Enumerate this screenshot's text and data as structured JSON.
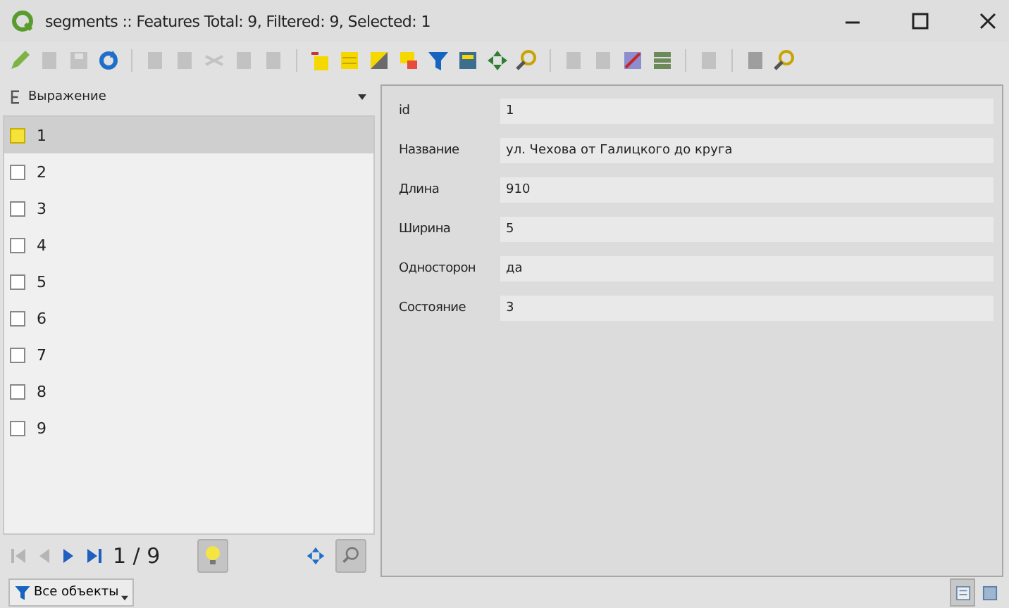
{
  "window": {
    "title": "segments :: Features Total: 9, Filtered: 9, Selected: 1"
  },
  "toolbar": [
    [
      {
        "kind": "pencil",
        "disabled": false
      },
      {
        "kind": "doc",
        "disabled": true
      },
      {
        "kind": "save",
        "disabled": true
      },
      {
        "kind": "refresh",
        "disabled": false
      }
    ],
    [
      {
        "kind": "doc",
        "disabled": true
      },
      {
        "kind": "doc",
        "disabled": true
      },
      {
        "kind": "scissors",
        "disabled": true
      },
      {
        "kind": "doc",
        "disabled": true
      },
      {
        "kind": "doc",
        "disabled": true
      }
    ],
    [
      {
        "kind": "select-expr",
        "disabled": false
      },
      {
        "kind": "select-all",
        "disabled": false
      },
      {
        "kind": "invert",
        "disabled": false
      },
      {
        "kind": "deselect",
        "disabled": false
      },
      {
        "kind": "filter",
        "disabled": false
      },
      {
        "kind": "move-top",
        "disabled": false
      },
      {
        "kind": "pan",
        "disabled": false
      },
      {
        "kind": "zoom",
        "disabled": false
      }
    ],
    [
      {
        "kind": "doc",
        "disabled": true
      },
      {
        "kind": "doc",
        "disabled": true
      },
      {
        "kind": "delete-field",
        "disabled": false
      },
      {
        "kind": "calc-field",
        "disabled": false
      }
    ],
    [
      {
        "kind": "doc",
        "disabled": true
      }
    ],
    [
      {
        "kind": "doc",
        "disabled": false
      },
      {
        "kind": "zoom",
        "disabled": false
      }
    ]
  ],
  "list_header": {
    "label": "Выражение"
  },
  "rows": [
    {
      "label": "1",
      "selected": true
    },
    {
      "label": "2",
      "selected": false
    },
    {
      "label": "3",
      "selected": false
    },
    {
      "label": "4",
      "selected": false
    },
    {
      "label": "5",
      "selected": false
    },
    {
      "label": "6",
      "selected": false
    },
    {
      "label": "7",
      "selected": false
    },
    {
      "label": "8",
      "selected": false
    },
    {
      "label": "9",
      "selected": false
    }
  ],
  "navigation": {
    "counter": "1 / 9",
    "buttons": [
      {
        "kind": "first",
        "disabled": true
      },
      {
        "kind": "prev",
        "disabled": true
      },
      {
        "kind": "next",
        "disabled": false
      },
      {
        "kind": "last",
        "disabled": false
      }
    ],
    "highlight_on": true,
    "pan_on": false,
    "zoom_on": true
  },
  "form": [
    {
      "label": "id",
      "value": "1"
    },
    {
      "label": "Название",
      "value": "ул. Чехова от Галицкого до круга"
    },
    {
      "label": "Длина",
      "value": "910"
    },
    {
      "label": "Ширина",
      "value": "5"
    },
    {
      "label": "Односторон",
      "value": "да"
    },
    {
      "label": "Состояние",
      "value": "3"
    }
  ],
  "status_bar": {
    "filter_label": "Все объекты",
    "view": [
      {
        "kind": "form",
        "selected": true
      },
      {
        "kind": "table",
        "selected": false
      }
    ]
  }
}
